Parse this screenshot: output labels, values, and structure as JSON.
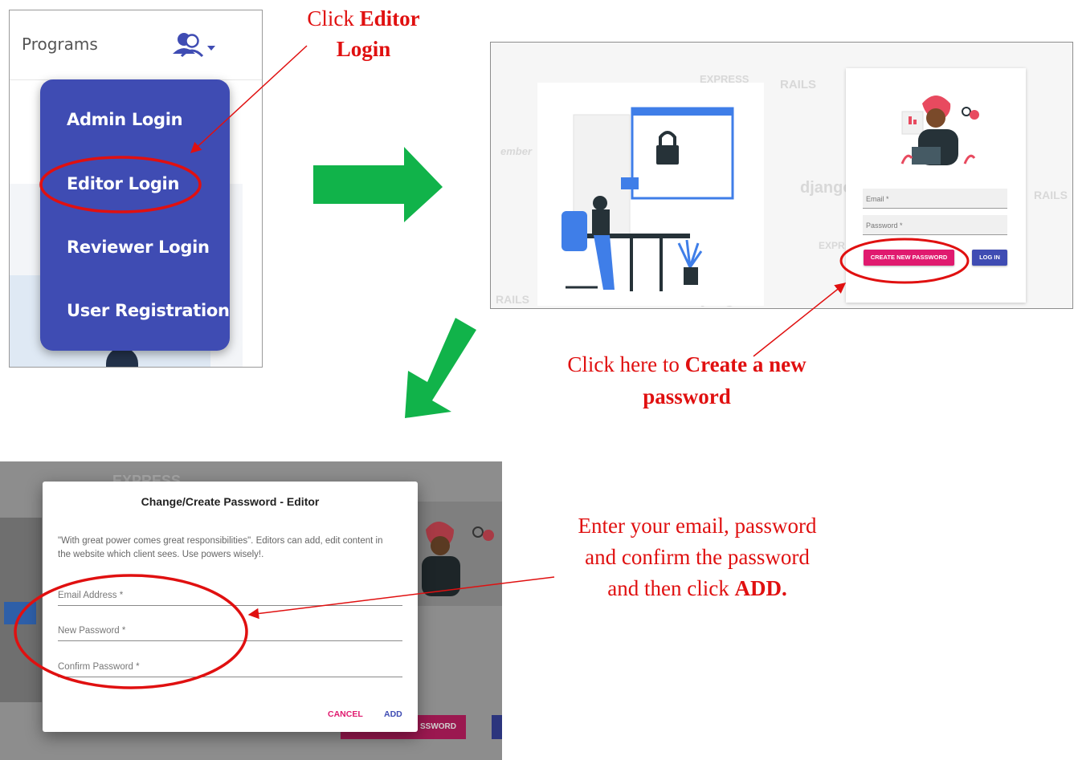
{
  "panel1": {
    "nav_label": "Programs",
    "user_menu_icon": "users-icon",
    "menu_items": [
      "Admin Login",
      "Editor Login",
      "Reviewer Login",
      "User Registration"
    ]
  },
  "panel2": {
    "watermarks": [
      "EXPRESS",
      "RAILS",
      "django",
      "EXPR",
      "RAILS",
      "django",
      "RAILS",
      "ember"
    ],
    "email_label": "Email *",
    "password_label": "Password *",
    "create_button": "CREATE NEW PASSWORD",
    "login_button": "LOG IN"
  },
  "panel3": {
    "background_watermark": "EXPRESS",
    "dialog_title": "Change/Create Password - Editor",
    "dialog_text": "\"With great power comes great responsibilities\". Editors can add, edit content in the website which client sees. Use powers wisely!.",
    "email_label": "Email Address *",
    "new_password_label": "New Password *",
    "confirm_password_label": "Confirm Password *",
    "cancel_label": "CANCEL",
    "add_label": "ADD",
    "bg_button_partial": "SSWORD"
  },
  "annotations": {
    "a1_prefix": "Click ",
    "a1_bold1": "Editor",
    "a1_bold2": "Login",
    "a2_prefix": "Click here to ",
    "a2_bold1": "Create a new",
    "a2_bold2": "password",
    "a3_line1": "Enter your email, password",
    "a3_line2": "and confirm the password",
    "a3_line3_prefix": "and then click ",
    "a3_bold": "ADD."
  },
  "colors": {
    "annotation_red": "#e01010",
    "arrow_green": "#11b34a",
    "menu_blue": "#3f4cb3",
    "create_pink": "#e01a6f"
  }
}
